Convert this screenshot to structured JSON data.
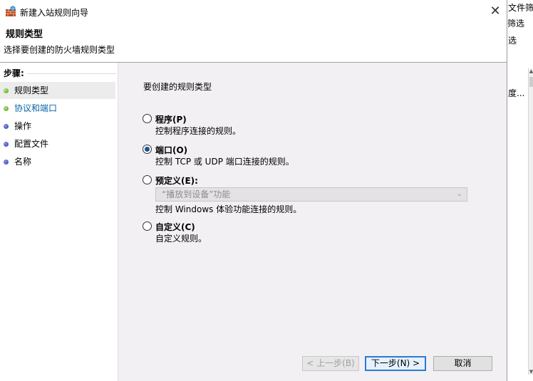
{
  "window": {
    "title": "新建入站规则向导",
    "close_glyph": "✕"
  },
  "header": {
    "title": "规则类型",
    "subtitle": "选择要创建的防火墙规则类型"
  },
  "steps": {
    "heading": "步骤:",
    "items": [
      {
        "label": "规则类型",
        "state": "current"
      },
      {
        "label": "协议和端口",
        "state": "link"
      },
      {
        "label": "操作",
        "state": "pending"
      },
      {
        "label": "配置文件",
        "state": "pending"
      },
      {
        "label": "名称",
        "state": "pending"
      }
    ]
  },
  "content": {
    "question": "要创建的规则类型",
    "options": [
      {
        "title": "程序(P)",
        "desc": "控制程序连接的规则。",
        "checked": false
      },
      {
        "title": "端口(O)",
        "desc": "控制 TCP 或 UDP 端口连接的规则。",
        "checked": true
      },
      {
        "title": "预定义(E):",
        "desc": "控制 Windows 体验功能连接的规则。",
        "checked": false
      },
      {
        "title": "自定义(C)",
        "desc": "自定义规则。",
        "checked": false
      }
    ],
    "predefined_select": {
      "value": "“播放到设备”功能",
      "arrow": "⌄"
    }
  },
  "buttons": {
    "back": "< 上一步(B)",
    "next": "下一步(N) >",
    "cancel": "取消"
  },
  "background_window": {
    "text_lines": [
      "文件筛",
      "筛选",
      "选",
      "度..."
    ]
  },
  "colors": {
    "accent": "#2a7bd4",
    "link": "#0a64a8",
    "content_bg": "#f3f0f3"
  }
}
